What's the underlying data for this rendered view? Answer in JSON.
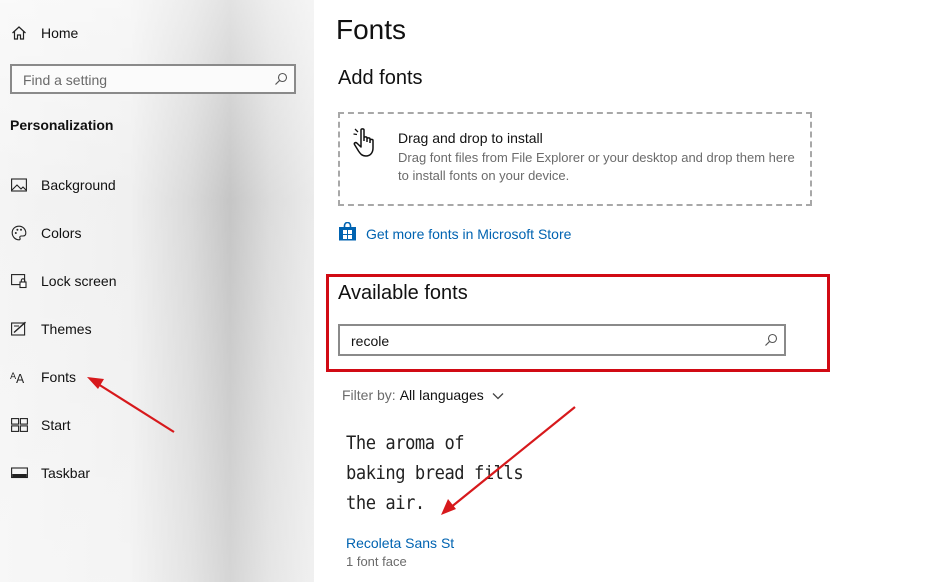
{
  "sidebar": {
    "home_label": "Home",
    "search_placeholder": "Find a setting",
    "section_title": "Personalization",
    "items": [
      {
        "label": "Background",
        "icon": "picture-icon"
      },
      {
        "label": "Colors",
        "icon": "palette-icon"
      },
      {
        "label": "Lock screen",
        "icon": "lock-screen-icon"
      },
      {
        "label": "Themes",
        "icon": "themes-icon"
      },
      {
        "label": "Fonts",
        "icon": "fonts-icon"
      },
      {
        "label": "Start",
        "icon": "start-icon"
      },
      {
        "label": "Taskbar",
        "icon": "taskbar-icon"
      }
    ]
  },
  "main": {
    "page_title": "Fonts",
    "add_fonts": {
      "heading": "Add fonts",
      "drop_title": "Drag and drop to install",
      "drop_desc": "Drag font files from File Explorer or your desktop and drop them here to install fonts on your device.",
      "store_link": "Get more fonts in Microsoft Store"
    },
    "available": {
      "heading": "Available fonts",
      "search_value": "recole",
      "filter_label": "Filter by:",
      "filter_value": "All languages"
    },
    "font_card": {
      "preview_lines": [
        "The aroma of",
        "baking bread fills",
        "the air."
      ],
      "name": "Recoleta Sans St",
      "faces": "1 font face"
    }
  },
  "colors": {
    "accent": "#0063b1",
    "highlight": "#d10a14"
  }
}
